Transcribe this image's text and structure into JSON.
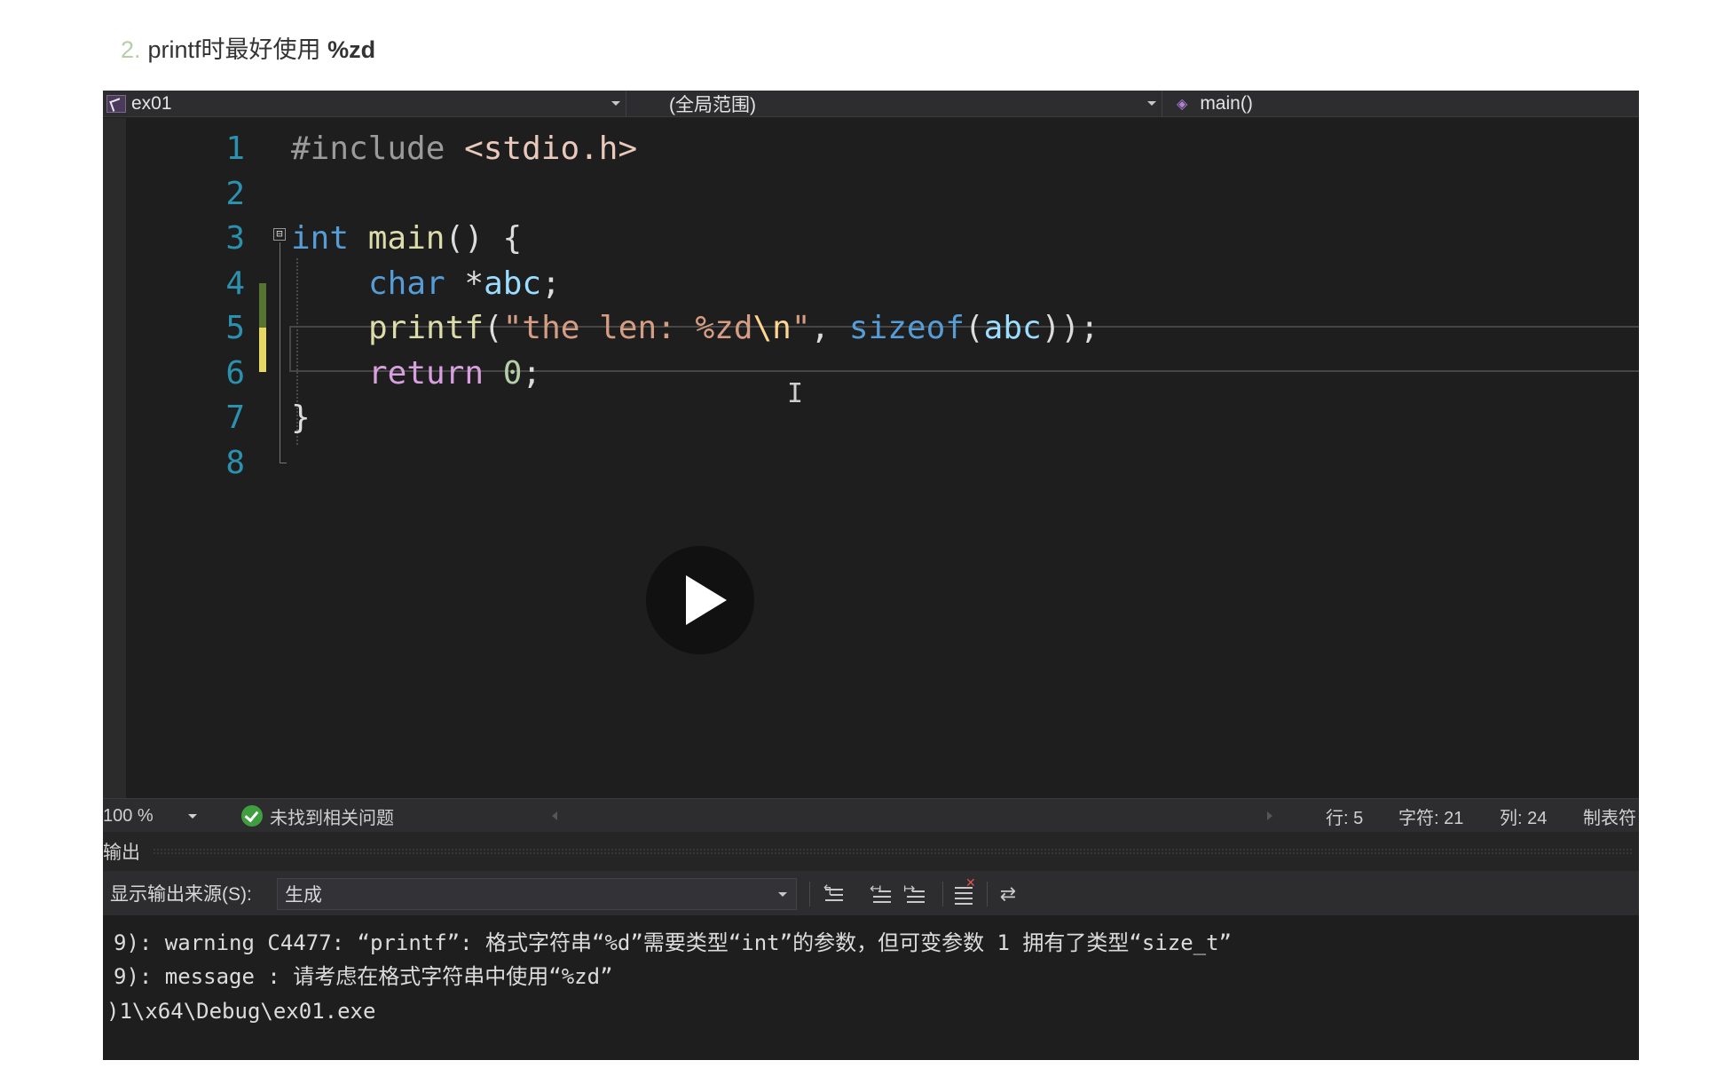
{
  "heading": {
    "number": "2.",
    "text": "printf时最好使用",
    "bold": "%zd"
  },
  "navbar": {
    "project": "ex01",
    "scope": "(全局范围)",
    "member": "main()",
    "project_icon": "project-icon",
    "member_icon": "cube-icon"
  },
  "editor": {
    "line_numbers": [
      "1",
      "2",
      "3",
      "4",
      "5",
      "6",
      "7",
      "8"
    ],
    "lines": {
      "l1_directive": "#include",
      "l1_header": "<stdio.h>",
      "l3_type": "int",
      "l3_name": "main",
      "l3_rest": "() {",
      "l4_type": "char",
      "l4_rest": " *",
      "l4_var": "abc",
      "l4_end": ";",
      "l5_fn": "printf",
      "l5_open": "(",
      "l5_str_a": "\"the len: %zd",
      "l5_esc": "\\n",
      "l5_str_b": "\"",
      "l5_comma": ", ",
      "l5_sizeof": "sizeof",
      "l5_open2": "(",
      "l5_arg": "abc",
      "l5_close": "));",
      "l6_kw": "return",
      "l6_num": "0",
      "l6_end": ";",
      "l7_brace": "}"
    },
    "fold_glyph": "⊟",
    "cursor_glyph": "I",
    "play_icon": "play-icon"
  },
  "statusbar": {
    "zoom": "100 %",
    "issues": "未找到相关问题",
    "row": "行: 5",
    "char": "字符: 21",
    "col": "列: 24",
    "tab": "制表符"
  },
  "output": {
    "title": "输出",
    "source_label": "显示输出来源(S):",
    "source_value": "生成",
    "toolbar_icons": [
      "goto-prev-message-icon",
      "goto-prev-icon",
      "goto-next-icon",
      "clear-all-icon",
      "toggle-word-wrap-icon"
    ],
    "lines": [
      "9): warning C4477: “printf”: 格式字符串“%d”需要类型“int”的参数，但可变参数 1 拥有了类型“size_t”",
      "9): message : 请考虑在格式字符串中使用“%zd”",
      ")1\\x64\\Debug\\ex01.exe"
    ]
  }
}
